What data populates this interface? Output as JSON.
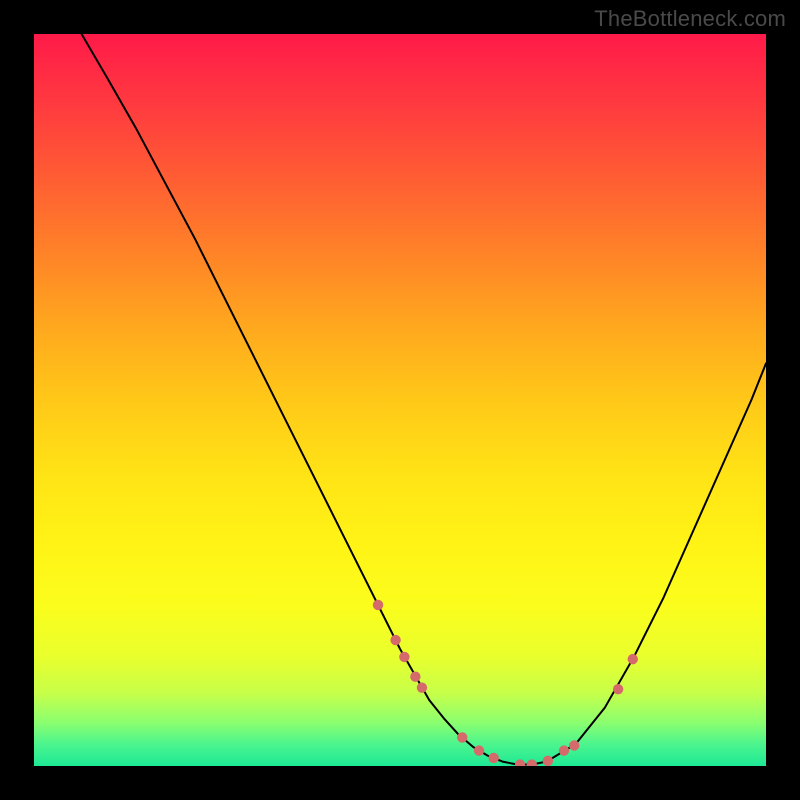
{
  "watermark": "TheBottleneck.com",
  "chart_data": {
    "type": "line",
    "title": "",
    "xlabel": "",
    "ylabel": "",
    "xlim": [
      0,
      100
    ],
    "ylim": [
      0,
      100
    ],
    "series": [
      {
        "name": "curve",
        "x": [
          6.5,
          10,
          14,
          18,
          22,
          26,
          30,
          34,
          38,
          42,
          46,
          50,
          54,
          56,
          58,
          60,
          62,
          64,
          66,
          68,
          70,
          74,
          78,
          82,
          86,
          90,
          94,
          98,
          100
        ],
        "y": [
          100,
          94,
          87,
          79.5,
          72,
          64,
          56,
          48,
          40,
          32,
          24,
          16,
          9,
          6.5,
          4.3,
          2.6,
          1.4,
          0.6,
          0.2,
          0.2,
          0.6,
          3,
          8,
          15,
          23,
          32,
          41,
          50,
          55
        ]
      }
    ],
    "markers": {
      "color": "#d46a6a",
      "radius": 5.2,
      "x": [
        47,
        49.4,
        50.6,
        52.1,
        53.0,
        58.5,
        60.8,
        62.8,
        66.4,
        68.0,
        70.2,
        72.4,
        73.8,
        79.8,
        81.8
      ],
      "y": [
        22.0,
        17.2,
        14.9,
        12.2,
        10.7,
        3.9,
        2.1,
        1.1,
        0.2,
        0.2,
        0.7,
        2.1,
        2.8,
        10.5,
        14.6
      ]
    },
    "gradient_stops": [
      {
        "offset": 0.0,
        "color": "#ff1a49"
      },
      {
        "offset": 0.1,
        "color": "#ff3b3f"
      },
      {
        "offset": 0.2,
        "color": "#ff5e33"
      },
      {
        "offset": 0.3,
        "color": "#ff8327"
      },
      {
        "offset": 0.4,
        "color": "#ffa81e"
      },
      {
        "offset": 0.5,
        "color": "#ffc818"
      },
      {
        "offset": 0.6,
        "color": "#ffe316"
      },
      {
        "offset": 0.7,
        "color": "#fff416"
      },
      {
        "offset": 0.78,
        "color": "#fbfd1c"
      },
      {
        "offset": 0.85,
        "color": "#e9ff2d"
      },
      {
        "offset": 0.9,
        "color": "#c7ff49"
      },
      {
        "offset": 0.94,
        "color": "#8cff6e"
      },
      {
        "offset": 0.97,
        "color": "#4cf58e"
      },
      {
        "offset": 1.0,
        "color": "#1de995"
      }
    ]
  }
}
